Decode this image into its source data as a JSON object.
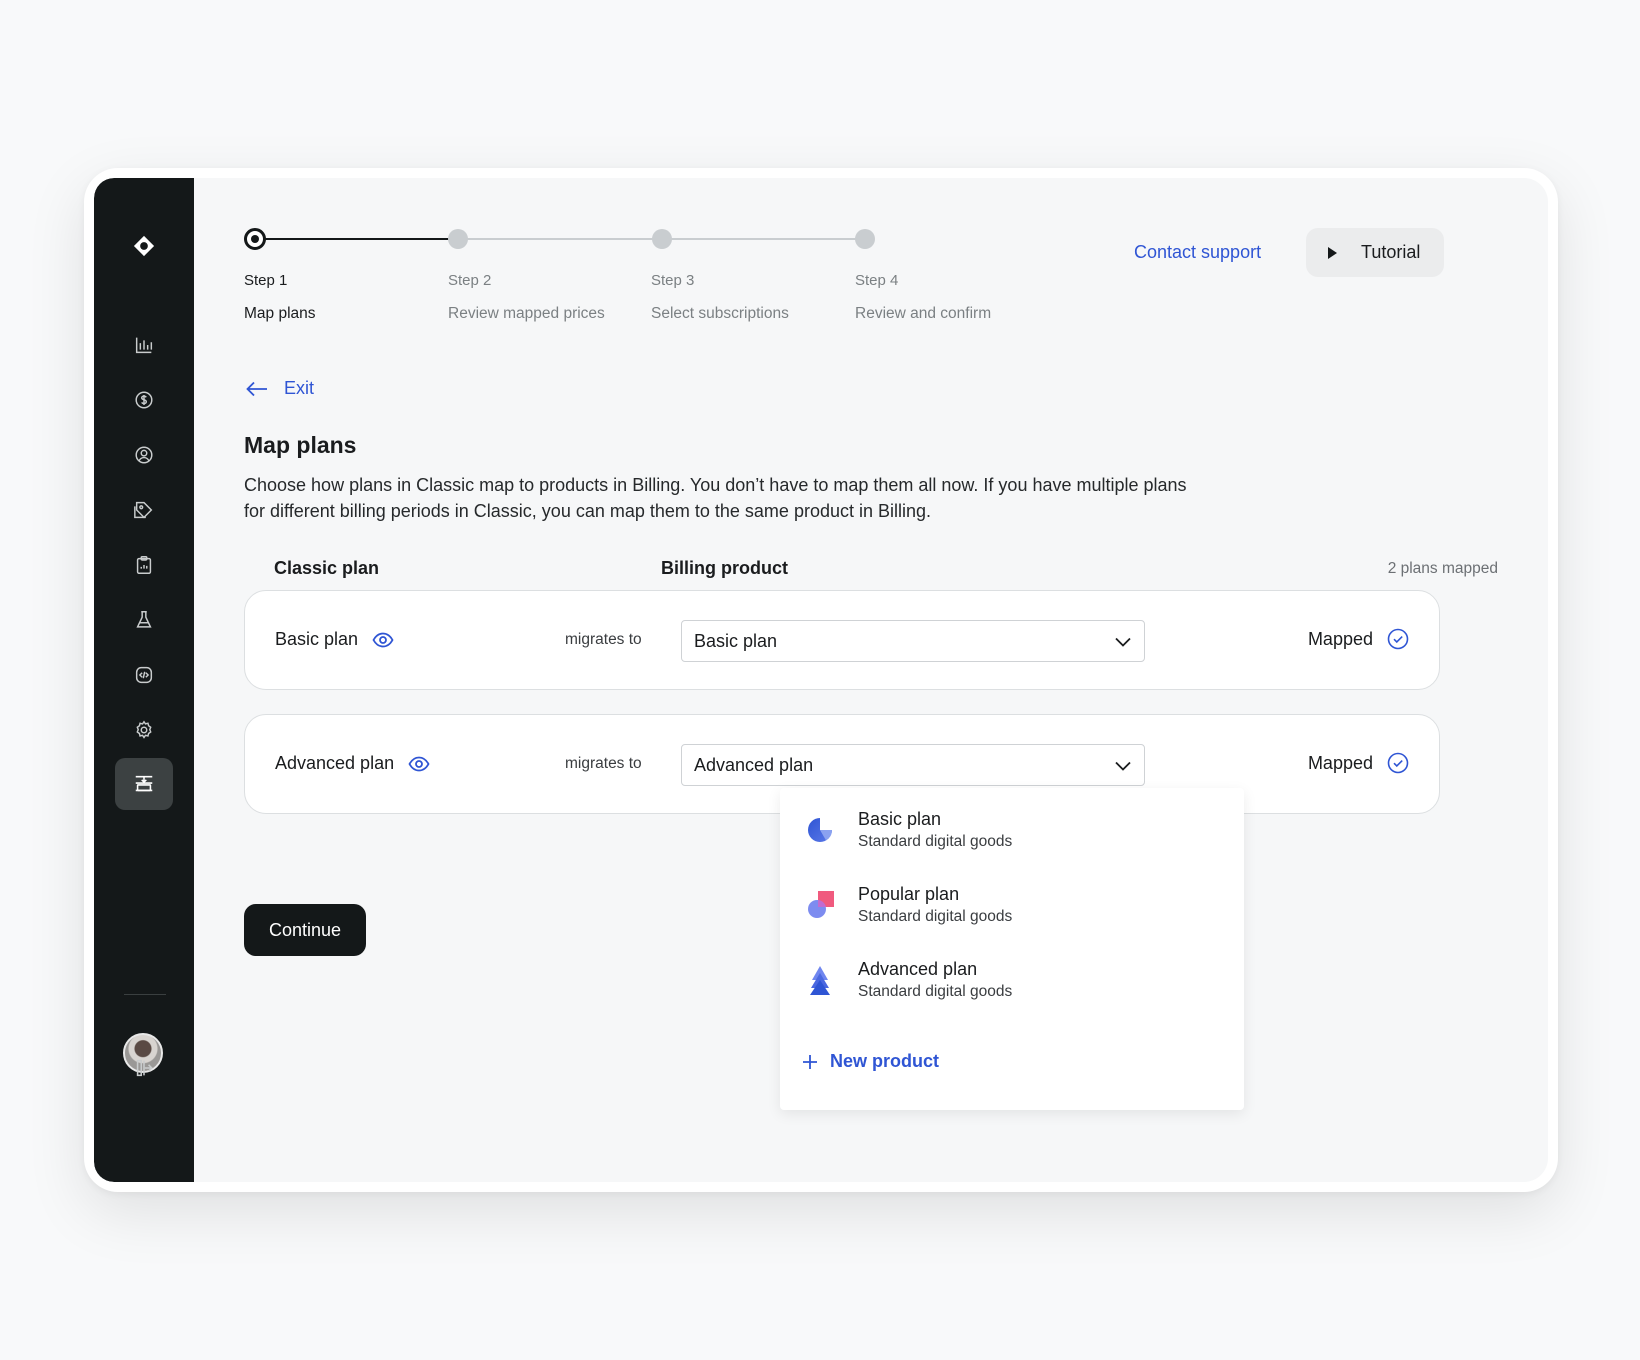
{
  "stepper": {
    "steps": [
      {
        "num": "Step 1",
        "name": "Map plans"
      },
      {
        "num": "Step 2",
        "name": "Review mapped prices"
      },
      {
        "num": "Step 3",
        "name": "Select subscriptions"
      },
      {
        "num": "Step 4",
        "name": "Review and confirm"
      }
    ],
    "current_step": 1
  },
  "header": {
    "contact_label": "Contact support",
    "tutorial_label": "Tutorial"
  },
  "page": {
    "exit_label": "Exit",
    "title": "Map plans",
    "description": "Choose how plans in Classic map to products in Billing. You don’t have to map them all now. If you have multiple plans for different billing periods in Classic, you can map them to the same product in Billing."
  },
  "table": {
    "col_classic": "Classic plan",
    "col_billing": "Billing product",
    "mapped_count": "2 plans mapped",
    "rows": [
      {
        "plan": "Basic plan",
        "migrates": "migrates to",
        "selected": "Basic plan",
        "status": "Mapped"
      },
      {
        "plan": "Advanced plan",
        "migrates": "migrates to",
        "selected": "Advanced plan",
        "status": "Mapped"
      }
    ]
  },
  "continue_label": "Continue",
  "dropdown": {
    "options": [
      {
        "name": "Basic plan",
        "sub": "Standard digital goods",
        "icon": "pie-icon"
      },
      {
        "name": "Popular plan",
        "sub": "Standard digital goods",
        "icon": "shapes-icon"
      },
      {
        "name": "Advanced plan",
        "sub": "Standard digital goods",
        "icon": "pyramid-icon"
      }
    ],
    "new_product_label": "New product"
  },
  "colors": {
    "accent": "#2f55d4",
    "sidebar": "#141819",
    "button_dark": "#141819"
  }
}
